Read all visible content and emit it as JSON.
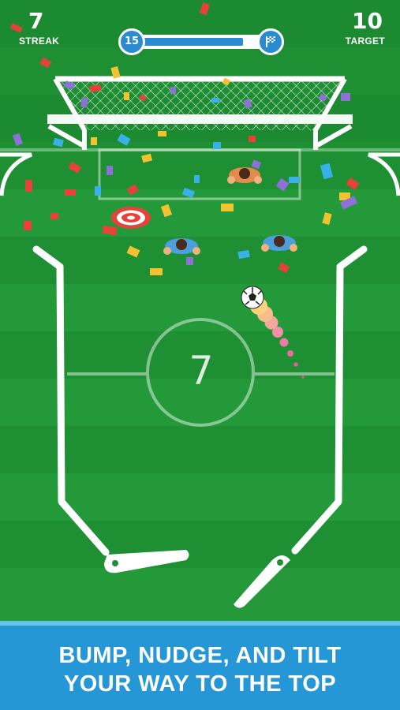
{
  "hud": {
    "streak": {
      "value": "7",
      "label": "STREAK"
    },
    "target": {
      "value": "10",
      "label": "TARGET"
    },
    "level": "15",
    "level_progress": 0.82
  },
  "field": {
    "center_number": "7",
    "icons": [
      "goal-net-icon",
      "target-icon",
      "soccer-ball-icon",
      "flipper-icon",
      "player-icon",
      "confetti-icon",
      "checkered-flag-icon"
    ]
  },
  "banner": {
    "line1": "BUMP, NUDGE, AND TILT",
    "line2": "YOUR WAY TO THE TOP"
  },
  "colors": {
    "pitch": "#1f8f34",
    "stripe": "#23993a",
    "line": "#ffffff",
    "banner": "#2596d6",
    "banner_top": "#68c3ee",
    "accent_blue": "#2a8bd0",
    "target_red": "#e8413a",
    "ball_trail": "#f07aa6"
  }
}
